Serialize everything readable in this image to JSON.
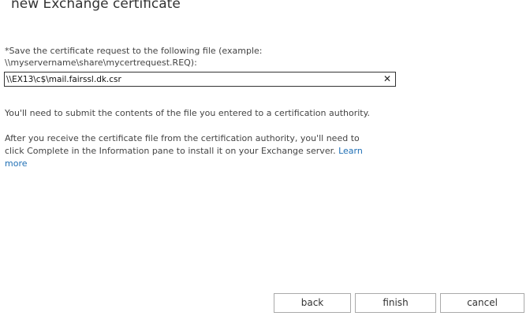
{
  "wizard": {
    "title": "new Exchange certificate"
  },
  "form": {
    "label": "*Save the certificate request to the following file (example: \\\\myservername\\share\\mycertrequest.REQ):",
    "path_value": "\\\\EX13\\c$\\mail.fairssl.dk.csr",
    "clear_glyph": "✕"
  },
  "info": {
    "paragraph1": "You'll need to submit the contents of the file you entered to a certification authority.",
    "paragraph2": "After you receive the certificate file from the certification authority, you'll need to click Complete in the Information pane to install it on your Exchange server.",
    "learn_more": "Learn more"
  },
  "buttons": {
    "back": "back",
    "finish": "finish",
    "cancel": "cancel"
  }
}
